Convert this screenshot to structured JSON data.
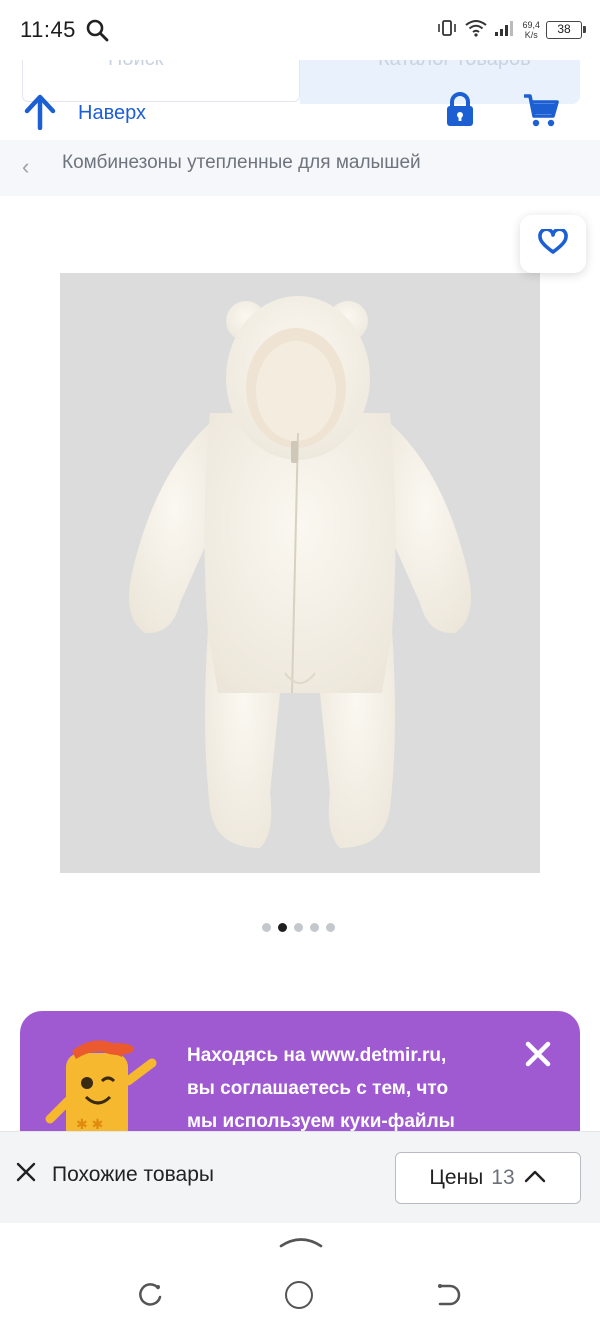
{
  "status_bar": {
    "time": "11:45",
    "net_speed_value": "69,4",
    "net_speed_unit": "K/s",
    "battery": "38"
  },
  "header": {
    "search_placeholder": "Поиск",
    "catalog_label": "Каталог товаров",
    "up_label": "Наверх"
  },
  "breadcrumb": {
    "text": "Комбинезоны утепленные для малышей"
  },
  "gallery": {
    "slide_count": 5,
    "active_index": 1
  },
  "cookie_banner": {
    "line1": "Находясь на www.detmir.ru,",
    "line2": "вы соглашаетесь с тем, что",
    "line3": "мы используем куки-файлы"
  },
  "bottom_panel": {
    "similar_label": "Похожие товары",
    "prices_label": "Цены",
    "prices_count": "13"
  },
  "colors": {
    "brand_blue": "#1c5fd3",
    "cookie_purple": "#9f5ad2"
  }
}
